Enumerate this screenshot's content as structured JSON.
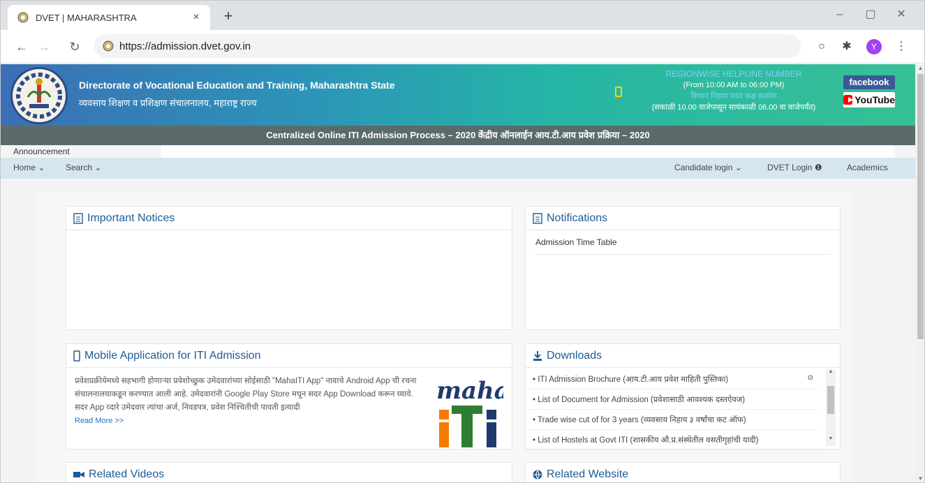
{
  "browser": {
    "tab_title": "DVET | MAHARASHTRA",
    "tab_close": "×",
    "new_tab": "+",
    "url": "https://admission.dvet.gov.in",
    "avatar_letter": "Y",
    "win_minimize": "–",
    "win_maximize": "▢",
    "win_close": "✕"
  },
  "header": {
    "org_en": "Directorate of Vocational Education and Training, Maharashtra State",
    "org_mr": "व्यवसाय शिक्षण व प्रशिक्षण संचालनालय, महाराष्ट्र राज्य",
    "helpline_title": "REGIONWISE HELPLINE NUMBER",
    "helpline_time": "(From 10:00 AM to 06:00 PM)",
    "helpline_title_mr": "विभाग निहाय मदत कक्ष क्रमांक",
    "helpline_time_mr": "(सकाळी 10.00 वाजेपासून सायंकाळी 06.00 वा वाजेपर्यंत)",
    "facebook": "facebook",
    "youtube": "YouTube"
  },
  "subbar": "Centralized Online ITI Admission Process – 2020   केंद्रीय ऑनलाईन आय.टी.आय प्रवेश प्रक्रिया – 2020",
  "announcement_label": "Announcement",
  "nav": {
    "home": "Home ⌄",
    "search": "Search ⌄",
    "candidate_login": "Candidate login ⌄",
    "dvet_login": "DVET Login ❶",
    "academics": "Academics"
  },
  "panels": {
    "important_notices": "Important Notices",
    "notifications": "Notifications",
    "notifications_items": [
      "Admission Time Table"
    ],
    "mobile_app": "Mobile Application for ITI Admission",
    "mobile_text": "प्रवेशप्रक्रीयेमध्ये सहभागी होणाऱ्या प्रवेशोच्छुक उमेदवारांच्या सोईसाठी \"MahaITI App\" नावाचे Android App ची रचना संचालनालयाकडून करण्यात आली आहे. उमेदवारांनी Google Play Store मधून सदर App Download करून घ्यावे. सदर App व्दारे उमेदवार त्यांचा अर्ज, निवडपत्र, प्रवेश निश्चितीची पावती इत्यादी",
    "read_more": "Read More >>",
    "downloads": "Downloads",
    "downloads_items": [
      "• ITI Admission Brochure (आय.टी.आय प्रवेश माहिती पुस्तिका)",
      "• List of Document for Admission (प्रवेशासाठी आवश्यक दस्तऐवज)",
      "• Trade wise cut of for 3 years (व्यवसाय निहाय ३ वर्षांचा कट ऑफ)",
      "• List of Hostels at Govt ITI (शासकीय औ.प्र.संस्थेतील वसतीगृहांची यादी)"
    ],
    "related_videos": "Related Videos",
    "related_website": "Related Website"
  },
  "maha_logo_text": "maha"
}
